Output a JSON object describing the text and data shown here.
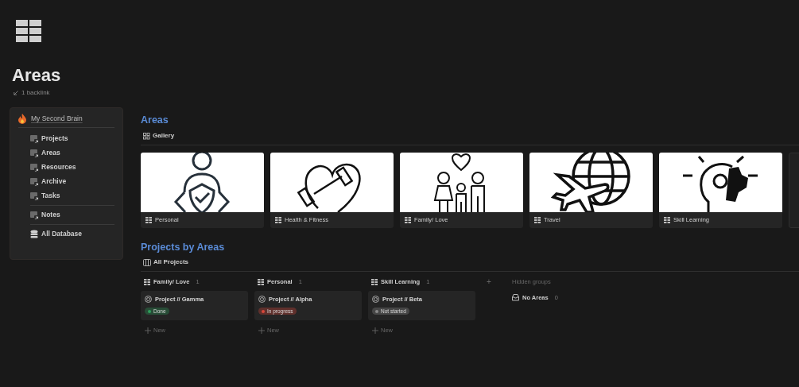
{
  "page": {
    "title": "Areas",
    "backlink": "1 backlink"
  },
  "sidebar": {
    "title": "My Second Brain",
    "sections": [
      [
        {
          "label": "Projects",
          "kind": "linked-page"
        },
        {
          "label": "Areas",
          "kind": "linked-page"
        },
        {
          "label": "Resources",
          "kind": "linked-page"
        },
        {
          "label": "Archive",
          "kind": "linked-page"
        },
        {
          "label": "Tasks",
          "kind": "linked-page"
        }
      ],
      [
        {
          "label": "Notes",
          "kind": "linked-page"
        }
      ],
      [
        {
          "label": "All Database",
          "kind": "database"
        }
      ]
    ]
  },
  "gallery": {
    "heading": "Areas",
    "view": "Gallery",
    "cards": [
      {
        "label": "Personal",
        "kind": "person"
      },
      {
        "label": "Health & Fitness",
        "kind": "fitness"
      },
      {
        "label": "Family/ Love",
        "kind": "family"
      },
      {
        "label": "Travel",
        "kind": "travel"
      },
      {
        "label": "Skill Learning",
        "kind": "skill"
      }
    ]
  },
  "board": {
    "heading": "Projects by Areas",
    "view": "All Projects",
    "columns": [
      {
        "title": "Family/ Love",
        "count": "1",
        "cards": [
          {
            "title": "Project // Gamma",
            "status": "Done",
            "color": "#2f9e5c"
          }
        ],
        "new": "New"
      },
      {
        "title": "Personal",
        "count": "1",
        "cards": [
          {
            "title": "Project // Alpha",
            "status": "In progress",
            "color": "#d9483b"
          }
        ],
        "new": "New"
      },
      {
        "title": "Skill Learning",
        "count": "1",
        "cards": [
          {
            "title": "Project // Beta",
            "status": "Not started",
            "color": "#8a8a8a"
          }
        ],
        "new": "New"
      }
    ],
    "add": "+",
    "hidden_label": "Hidden groups",
    "hidden": [
      {
        "title": "No Areas",
        "count": "0"
      }
    ]
  }
}
